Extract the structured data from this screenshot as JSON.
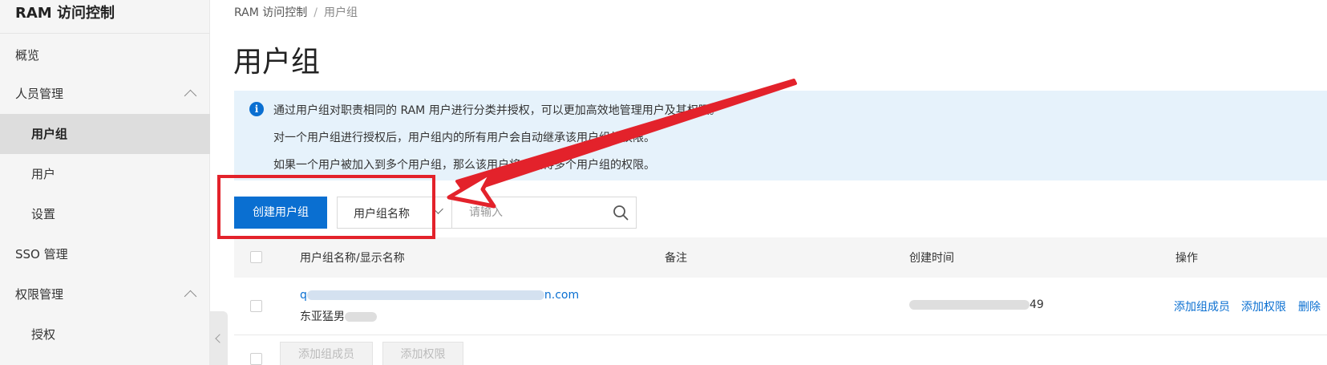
{
  "sidebar": {
    "title": "RAM 访问控制",
    "items": [
      {
        "label": "概览"
      },
      {
        "label": "人员管理"
      },
      {
        "label": "用户组"
      },
      {
        "label": "用户"
      },
      {
        "label": "设置"
      },
      {
        "label": "SSO 管理"
      },
      {
        "label": "权限管理"
      },
      {
        "label": "授权"
      }
    ]
  },
  "breadcrumb": {
    "root": "RAM 访问控制",
    "separator": "/",
    "current": "用户组"
  },
  "page": {
    "title": "用户组"
  },
  "info": {
    "icon": "info-icon",
    "lines": [
      "通过用户组对职责相同的 RAM 用户进行分类并授权，可以更加高效地管理用户及其权限。",
      "对一个用户组进行授权后，用户组内的所有用户会自动继承该用户组的权限。",
      "如果一个用户被加入到多个用户组，那么该用户将会获得多个用户组的权限。"
    ]
  },
  "toolbar": {
    "create_label": "创建用户组",
    "filter_selected": "用户组名称",
    "search_placeholder": "请输入"
  },
  "table": {
    "columns": [
      "用户组名称/显示名称",
      "备注",
      "创建时间",
      "操作"
    ],
    "rows": [
      {
        "name_prefix": "q",
        "name_suffix": "n.com",
        "display_prefix": "东亚猛男",
        "remark": "",
        "created_suffix": "49",
        "actions": [
          "添加组成员",
          "添加权限",
          "删除"
        ]
      }
    ],
    "bulk_actions": [
      "添加组成员",
      "添加权限"
    ]
  },
  "colors": {
    "primary": "#0a6fd1",
    "info_bg": "#e6f2fb",
    "annotation": "#e3222b"
  }
}
